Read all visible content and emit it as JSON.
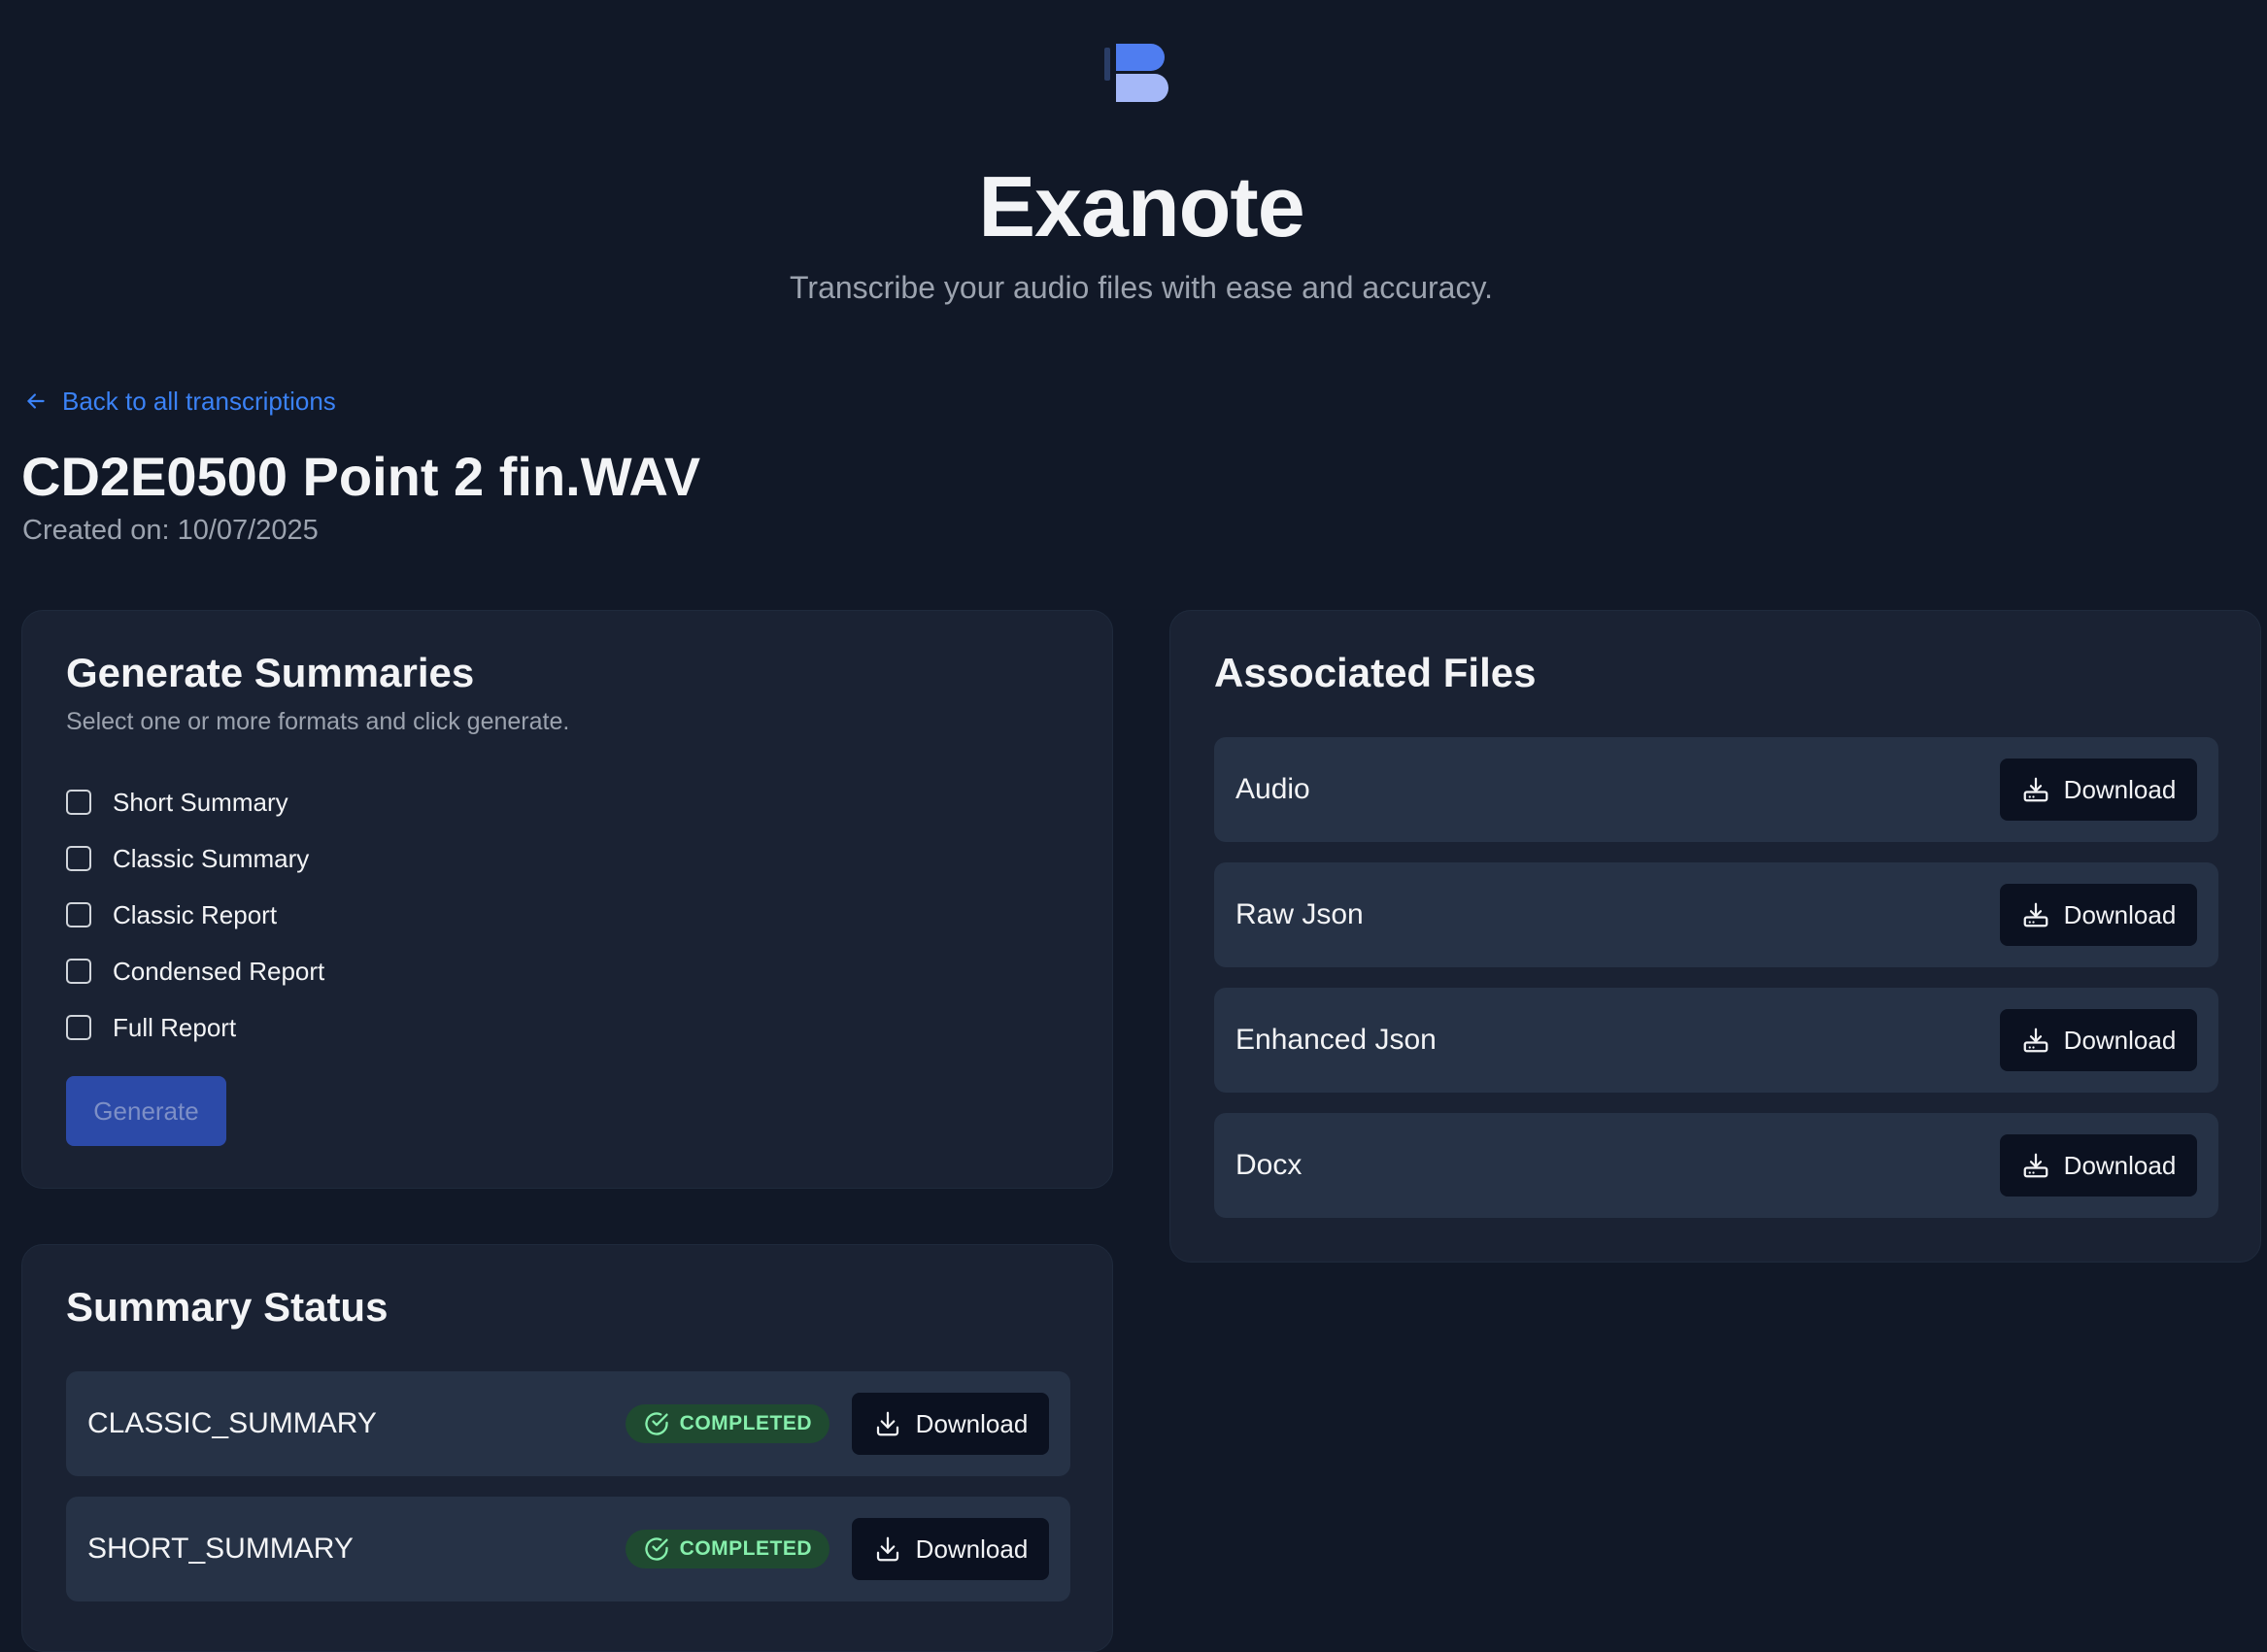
{
  "header": {
    "logo_icon": "exanote-logo-icon",
    "title": "Exanote",
    "subtitle": "Transcribe your audio files with ease and accuracy."
  },
  "back_link": {
    "label": "Back to all transcriptions",
    "icon": "arrow-left-icon"
  },
  "file": {
    "title": "CD2E0500 Point 2 fin.WAV",
    "created_on": "Created on: 10/07/2025"
  },
  "generate": {
    "title": "Generate Summaries",
    "description": "Select one or more formats and click generate.",
    "options": [
      {
        "label": "Short Summary",
        "checked": false
      },
      {
        "label": "Classic Summary",
        "checked": false
      },
      {
        "label": "Classic Report",
        "checked": false
      },
      {
        "label": "Condensed Report",
        "checked": false
      },
      {
        "label": "Full Report",
        "checked": false
      }
    ],
    "button_label": "Generate"
  },
  "files": {
    "title": "Associated Files",
    "items": [
      {
        "label": "Audio",
        "button_label": "Download"
      },
      {
        "label": "Raw Json",
        "button_label": "Download"
      },
      {
        "label": "Enhanced Json",
        "button_label": "Download"
      },
      {
        "label": "Docx",
        "button_label": "Download"
      }
    ]
  },
  "status": {
    "title": "Summary Status",
    "items": [
      {
        "label": "CLASSIC_SUMMARY",
        "status": "COMPLETED",
        "button_label": "Download"
      },
      {
        "label": "SHORT_SUMMARY",
        "status": "COMPLETED",
        "button_label": "Download"
      }
    ]
  },
  "colors": {
    "background": "#111827",
    "card": "#1a2233",
    "row": "#263246",
    "accent": "#3b82f6",
    "status_completed_bg": "#1f4a30",
    "status_completed_text": "#86efac"
  }
}
